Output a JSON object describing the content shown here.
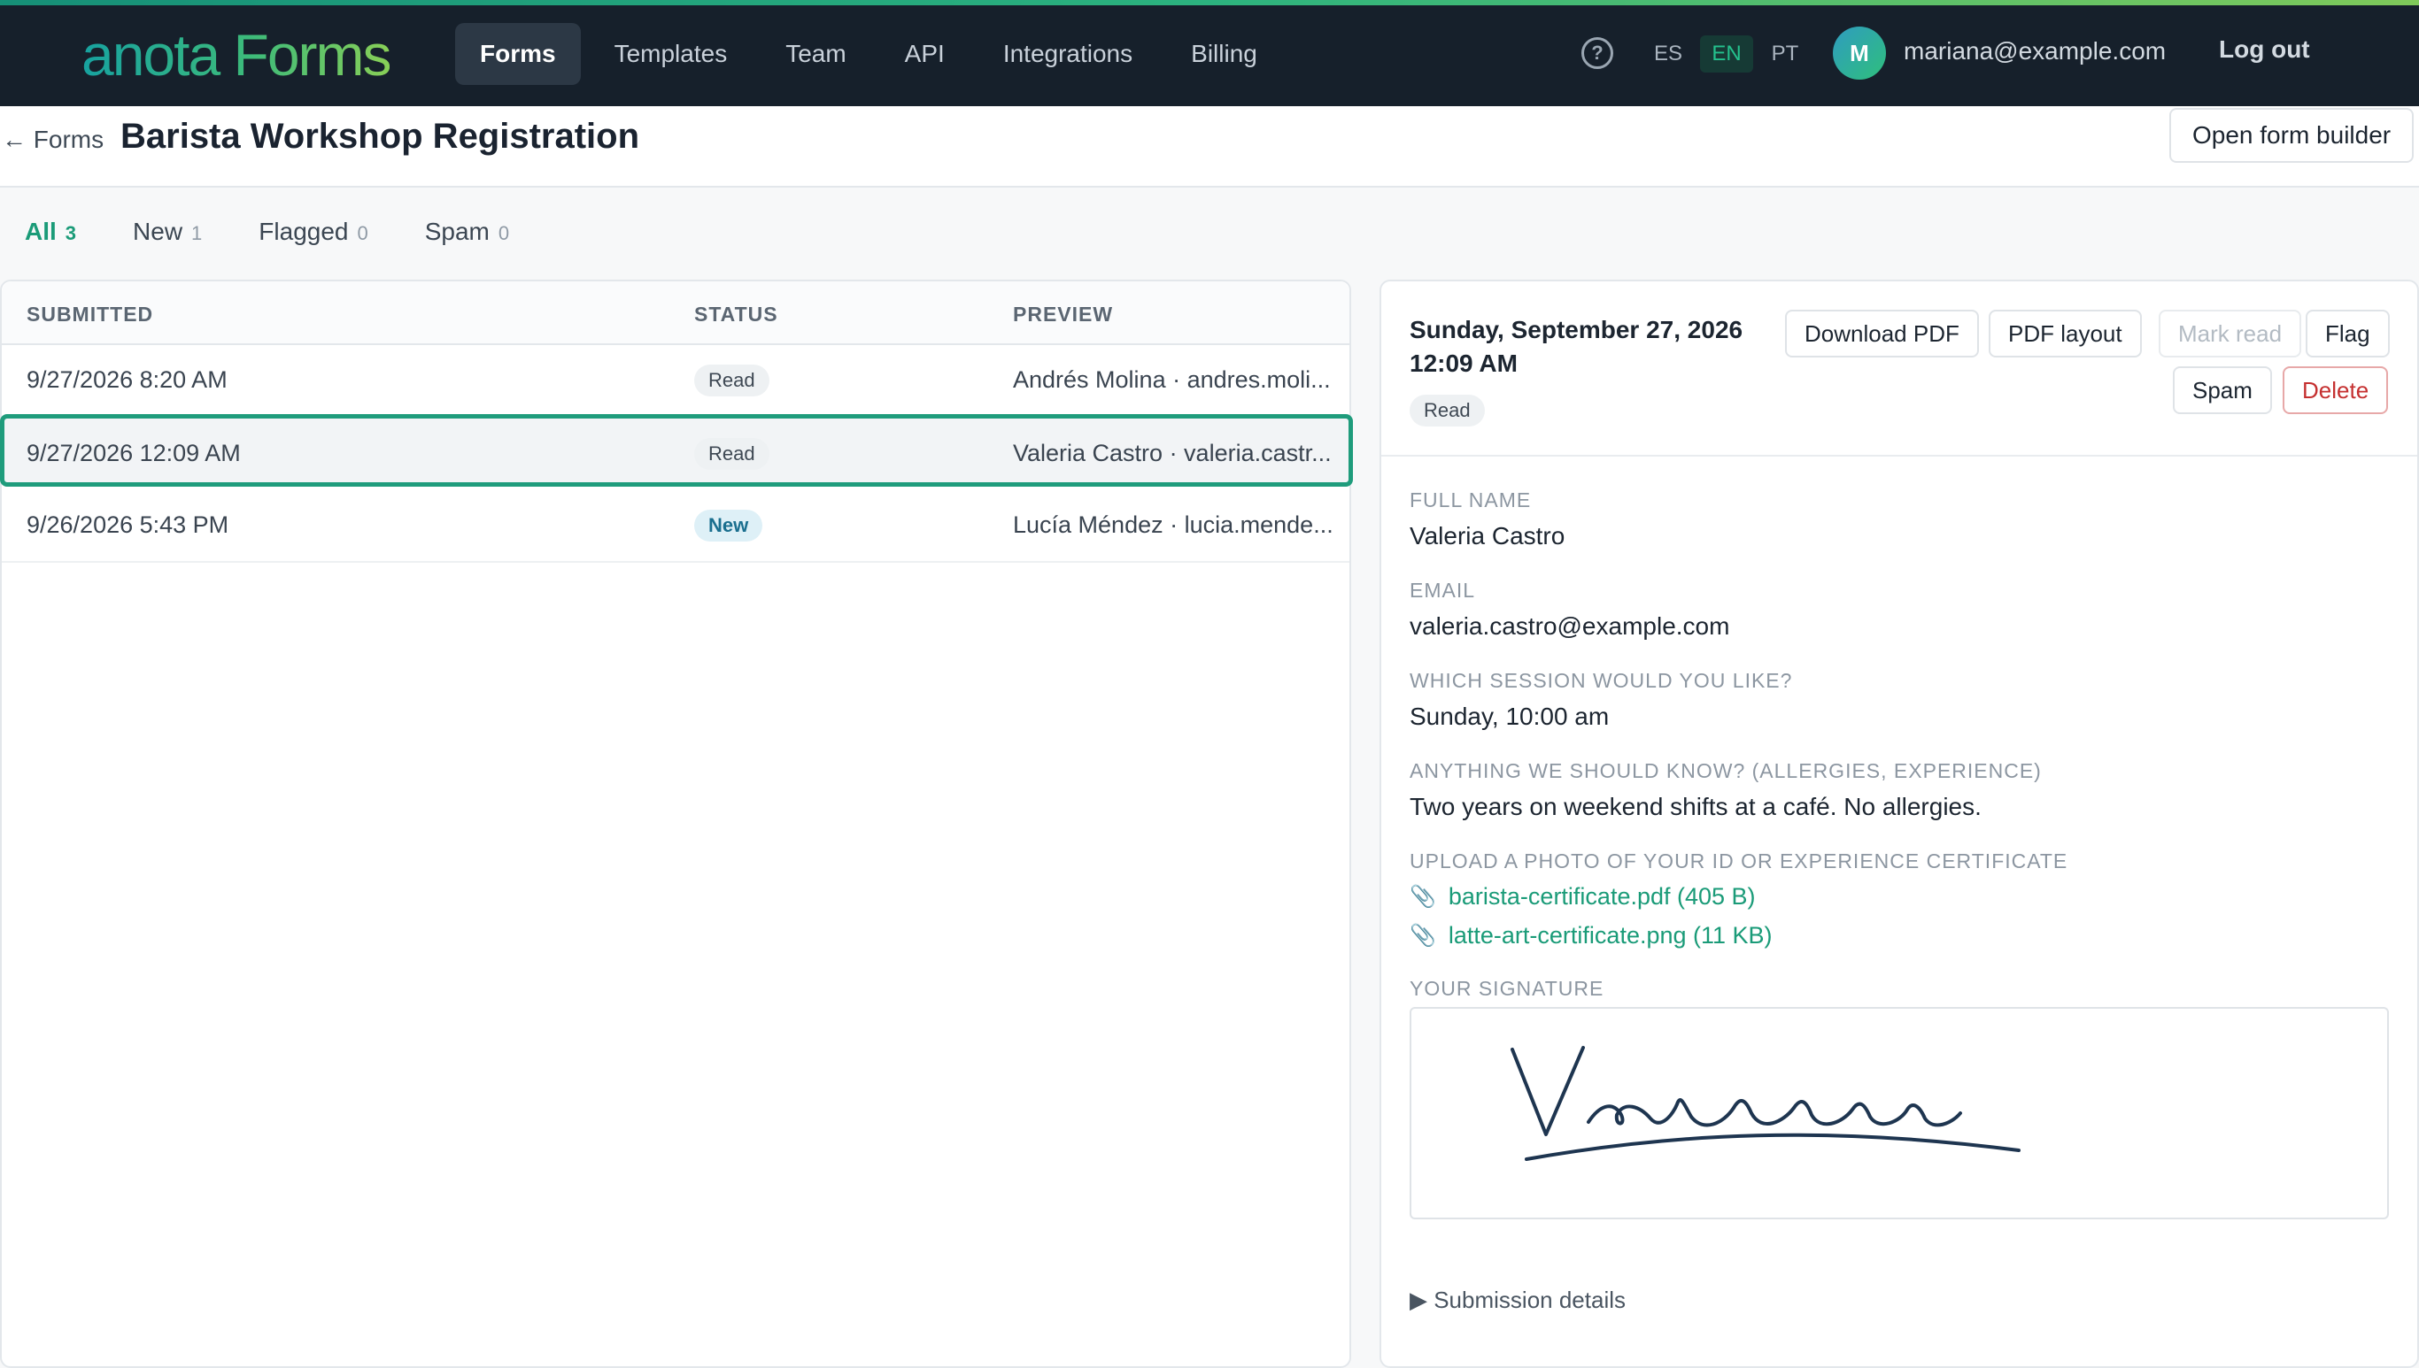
{
  "brand": {
    "logo_text": "anota Forms"
  },
  "nav": {
    "items": [
      {
        "label": "Forms",
        "active": true
      },
      {
        "label": "Templates",
        "active": false
      },
      {
        "label": "Team",
        "active": false
      },
      {
        "label": "API",
        "active": false
      },
      {
        "label": "Integrations",
        "active": false
      },
      {
        "label": "Billing",
        "active": false
      }
    ],
    "help_icon": "question-circle-icon",
    "help_glyph": "?",
    "languages": [
      {
        "code": "ES",
        "active": false
      },
      {
        "code": "EN",
        "active": true
      },
      {
        "code": "PT",
        "active": false
      }
    ],
    "user": {
      "avatar_initial": "M",
      "email": "mariana@example.com"
    },
    "logout_label": "Log out"
  },
  "header": {
    "back_label": "← Forms",
    "title": "Barista Workshop Registration",
    "open_builder_label": "Open form builder"
  },
  "tabs": [
    {
      "label": "All",
      "count": "3",
      "active": true
    },
    {
      "label": "New",
      "count": "1",
      "active": false
    },
    {
      "label": "Flagged",
      "count": "0",
      "active": false
    },
    {
      "label": "Spam",
      "count": "0",
      "active": false
    }
  ],
  "table": {
    "columns": [
      "SUBMITTED",
      "STATUS",
      "PREVIEW"
    ],
    "rows": [
      {
        "submitted": "9/27/2026 8:20 AM",
        "status": "Read",
        "preview": "Andrés Molina · andres.moli...",
        "selected": false
      },
      {
        "submitted": "9/27/2026 12:09 AM",
        "status": "Read",
        "preview": "Valeria Castro · valeria.castr...",
        "selected": true
      },
      {
        "submitted": "9/26/2026 5:43 PM",
        "status": "New",
        "preview": "Lucía Méndez · lucia.mende...",
        "selected": false
      }
    ]
  },
  "detail": {
    "date_line1": "Sunday, September 27, 2026",
    "date_line2": "12:09 AM",
    "status": "Read",
    "buttons": {
      "download_pdf": "Download PDF",
      "pdf_layout": "PDF layout",
      "mark_read": "Mark read",
      "flag": "Flag",
      "spam": "Spam",
      "delete": "Delete"
    },
    "fields": [
      {
        "label": "FULL NAME",
        "value": "Valeria Castro"
      },
      {
        "label": "EMAIL",
        "value": "valeria.castro@example.com"
      },
      {
        "label": "WHICH SESSION WOULD YOU LIKE?",
        "value": "Sunday, 10:00 am"
      },
      {
        "label": "ANYTHING WE SHOULD KNOW? (ALLERGIES, EXPERIENCE)",
        "value": "Two years on weekend shifts at a café. No allergies."
      }
    ],
    "upload_label": "UPLOAD A PHOTO OF YOUR ID OR EXPERIENCE CERTIFICATE",
    "attachments": [
      {
        "name": "barista-certificate.pdf (405 B)",
        "icon": "paperclip-icon"
      },
      {
        "name": "latte-art-certificate.png (11 KB)",
        "icon": "paperclip-icon"
      }
    ],
    "signature_label": "YOUR SIGNATURE",
    "submission_details_label": "▶ Submission details"
  },
  "colors": {
    "accent": "#1a9b78",
    "nav_bg": "#16202b",
    "danger": "#c53030",
    "signature_ink": "#1e3550"
  }
}
